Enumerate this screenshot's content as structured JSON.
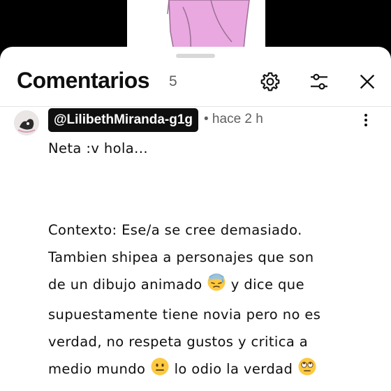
{
  "header": {
    "title": "Comentarios",
    "count": "5",
    "icons": {
      "settings": "gear-icon",
      "filter": "sliders-icon",
      "close": "close-icon"
    }
  },
  "comment": {
    "author": "@LilibethMiranda-g1g",
    "timestamp": "• hace 2 h",
    "first_line": "Neta :v hola...",
    "paragraph": {
      "line1": "Contexto: Ese/a se cree demasiado.",
      "line2": "Tambien shipea a personajes que son",
      "line3_text": "de un dibujo animado",
      "line3_tail": "y dice que",
      "line4": "supuestamente tiene novia pero no es",
      "line5": "verdad, no respeta gustos y critica a",
      "line6_text": "medio mundo",
      "line6_mid": "lo odio la verdad"
    },
    "emojis": [
      "downcast-sweat-face",
      "neutral-face",
      "eye-roll-face"
    ]
  },
  "colors": {
    "text": "#0f0f0f",
    "secondary": "#606060",
    "author_bg": "#0f0f0f",
    "divider": "#e5e5e5"
  }
}
